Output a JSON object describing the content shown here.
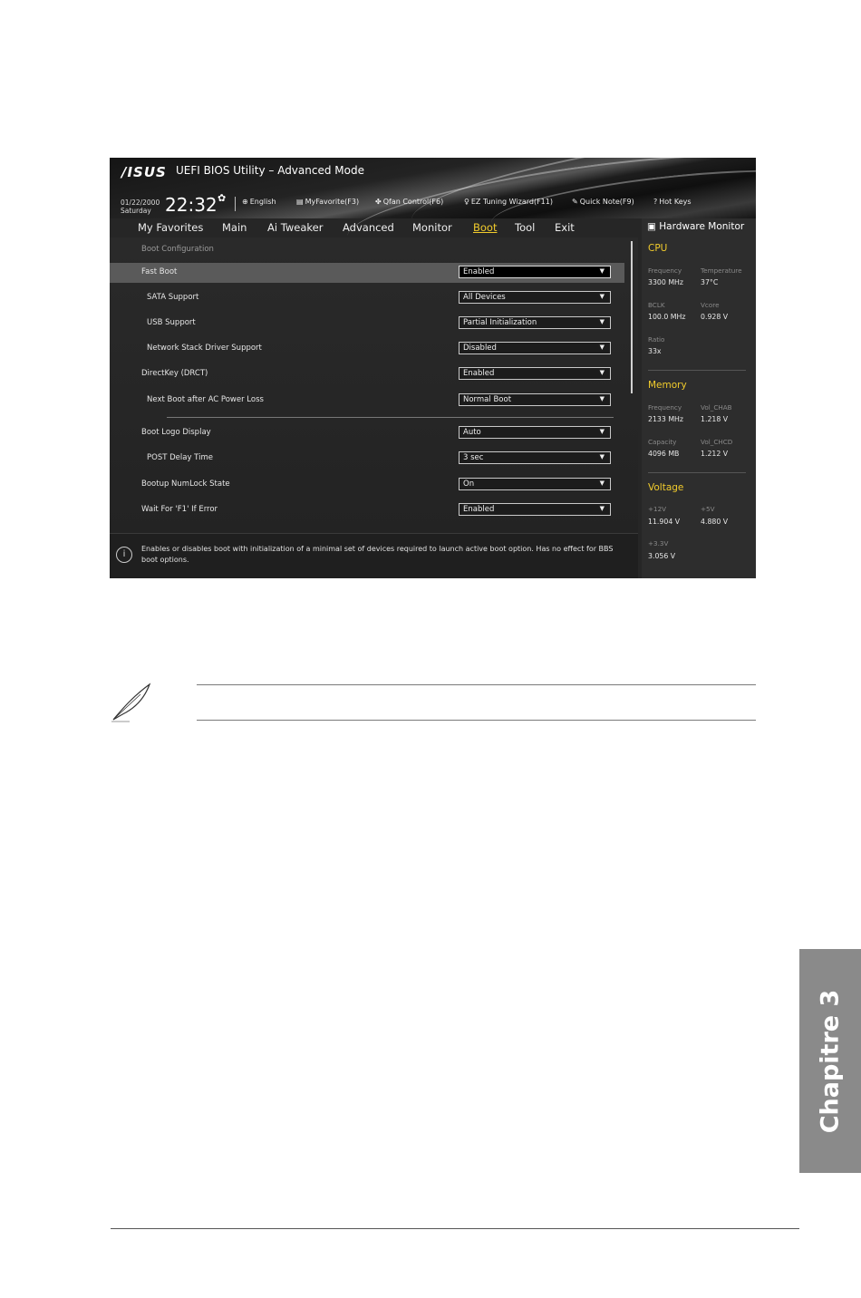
{
  "bios": {
    "logo": "/ISUS",
    "title": "UEFI BIOS Utility – Advanced Mode",
    "date": "01/22/2000",
    "day": "Saturday",
    "time": "22:32",
    "toolbar": [
      {
        "icon": "globe-icon",
        "label": "English"
      },
      {
        "icon": "my-favorite-icon",
        "label": "MyFavorite(F3)"
      },
      {
        "icon": "fan-icon",
        "label": "Qfan Control(F6)"
      },
      {
        "icon": "lightbulb-icon",
        "label": "EZ Tuning Wizard(F11)"
      },
      {
        "icon": "note-icon",
        "label": "Quick Note(F9)"
      },
      {
        "icon": "question-icon",
        "label": "Hot Keys"
      }
    ],
    "menu": [
      "My Favorites",
      "Main",
      "Ai Tweaker",
      "Advanced",
      "Monitor",
      "Boot",
      "Tool",
      "Exit"
    ],
    "active_menu": "Boot",
    "section_title": "Boot Configuration",
    "settings": [
      {
        "label": "Fast Boot",
        "value": "Enabled",
        "selected": true
      },
      {
        "label": "SATA Support",
        "value": "All Devices"
      },
      {
        "label": "USB Support",
        "value": "Partial Initialization"
      },
      {
        "label": "Network Stack Driver Support",
        "value": "Disabled"
      },
      {
        "label": "DirectKey (DRCT)",
        "value": "Enabled"
      },
      {
        "label": "Next Boot after AC Power Loss",
        "value": "Normal Boot"
      },
      {
        "label": "Boot Logo Display",
        "value": "Auto"
      },
      {
        "label": "POST Delay Time",
        "value": "3 sec"
      },
      {
        "label": "Bootup NumLock State",
        "value": "On"
      },
      {
        "label": "Wait For 'F1' If Error",
        "value": "Enabled"
      }
    ],
    "help_text": "Enables or disables boot with initialization of a minimal set of devices required to launch active boot option. Has no effect for BBS boot options."
  },
  "hw_monitor": {
    "title": "Hardware Monitor",
    "cpu": {
      "title": "CPU",
      "frequency_label": "Frequency",
      "frequency": "3300 MHz",
      "temperature_label": "Temperature",
      "temperature": "37°C",
      "bclk_label": "BCLK",
      "bclk": "100.0 MHz",
      "vcore_label": "Vcore",
      "vcore": "0.928 V",
      "ratio_label": "Ratio",
      "ratio": "33x"
    },
    "memory": {
      "title": "Memory",
      "frequency_label": "Frequency",
      "frequency": "2133 MHz",
      "volchab_label": "Vol_CHAB",
      "volchab": "1.218 V",
      "capacity_label": "Capacity",
      "capacity": "4096 MB",
      "volchcd_label": "Vol_CHCD",
      "volchcd": "1.212 V"
    },
    "voltage": {
      "title": "Voltage",
      "v12_label": "+12V",
      "v12": "11.904 V",
      "v5_label": "+5V",
      "v5": "4.880 V",
      "v33_label": "+3.3V",
      "v33": "3.056 V"
    }
  },
  "chapter_label": "Chapitre 3",
  "colors": {
    "accent": "#f2cc2c",
    "chapter_tab": "#8a8a8a"
  }
}
